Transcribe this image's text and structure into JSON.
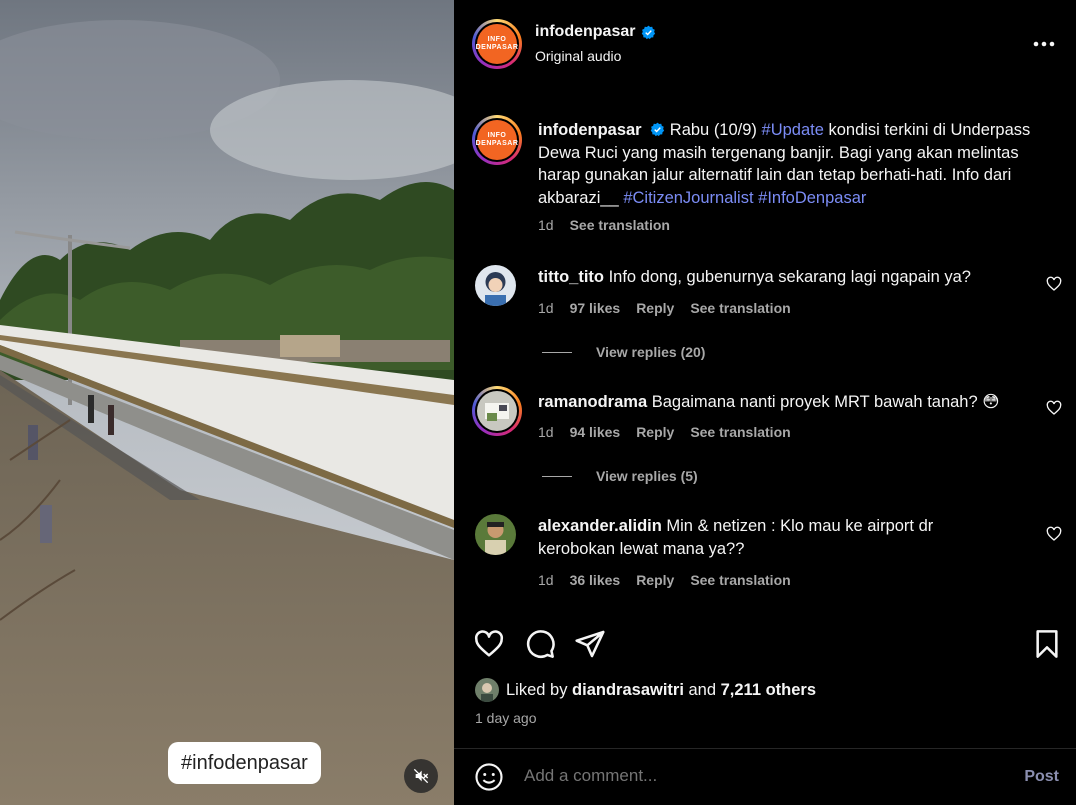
{
  "media": {
    "hashtag_sticker": "#infodenpasar",
    "mute_icon": "speaker-muted-icon"
  },
  "header": {
    "username": "infodenpasar",
    "subtitle": "Original audio",
    "avatar_text_1": "INFO",
    "avatar_text_2": "DENPASAR",
    "more_icon": "more-horizontal-icon"
  },
  "caption": {
    "username": "infodenpasar",
    "text_1": " Rabu (10/9) ",
    "tag_1": "#Update",
    "text_2": " kondisi terkini di Underpass Dewa Ruci yang masih tergenang banjir. Bagi yang akan melintas harap gunakan jalur alternatif lain dan tetap berhati-hati. Info dari akbarazi__ ",
    "tag_2": "#CitizenJournalist",
    "tag_3": "#InfoDenpasar",
    "time": "1d",
    "see_translation": "See translation"
  },
  "comments": [
    {
      "username": "titto_tito",
      "text": " Info dong, gubenurnya sekarang lagi ngapain ya?",
      "time": "1d",
      "likes": "97 likes",
      "reply": "Reply",
      "see_translation": "See translation",
      "view_replies": "View replies (20)"
    },
    {
      "username": "ramanodrama",
      "text": " Bagaimana nanti proyek MRT bawah tanah? 😳",
      "time": "1d",
      "likes": "94 likes",
      "reply": "Reply",
      "see_translation": "See translation",
      "view_replies": "View replies (5)"
    },
    {
      "username": "alexander.alidin",
      "text": " Min & netizen : Klo mau ke airport dr kerobokan lewat mana ya??",
      "time": "1d",
      "likes": "36 likes",
      "reply": "Reply",
      "see_translation": "See translation"
    }
  ],
  "likes": {
    "prefix": "Liked by ",
    "user": "diandrasawitri",
    "middle": " and ",
    "count": "7,211 others"
  },
  "time_ago": "1 day ago",
  "comment_box": {
    "placeholder": "Add a comment...",
    "post_label": "Post"
  },
  "colors": {
    "background": "#000000",
    "text": "#f5f5f5",
    "muted": "#a8a8a8",
    "hashtag": "#7b8cf5",
    "verified": "#0095f6",
    "avatar_orange": "#f26522"
  }
}
